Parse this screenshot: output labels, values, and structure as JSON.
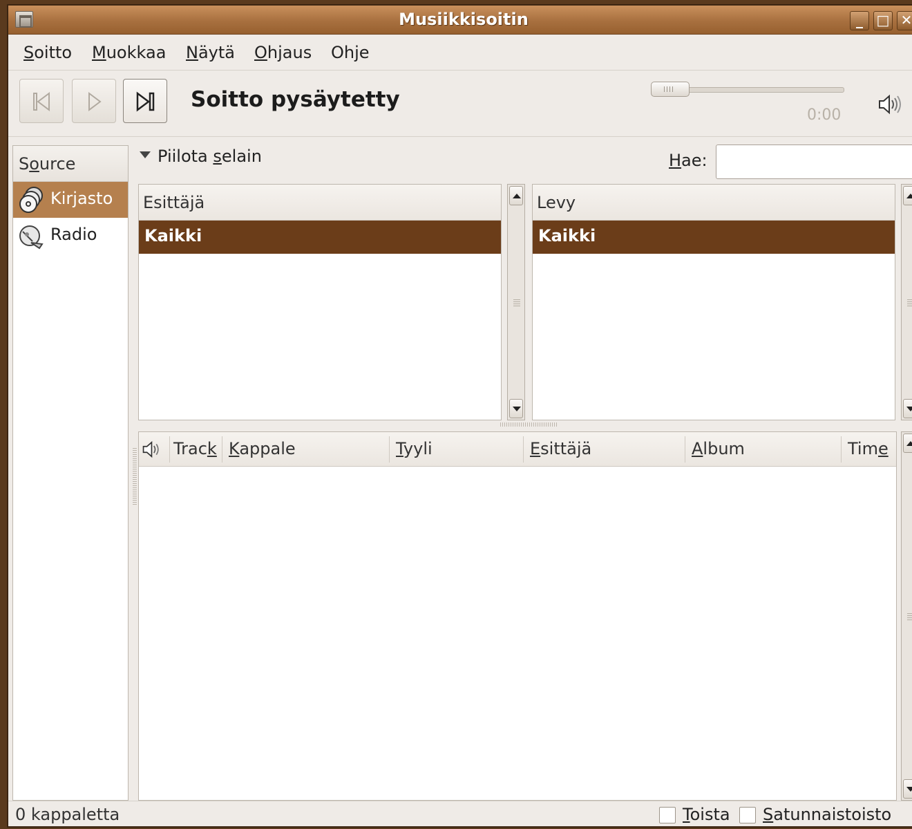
{
  "window": {
    "title": "Musiikkisoitin"
  },
  "menu": [
    {
      "pre": "",
      "u": "S",
      "post": "oitto"
    },
    {
      "pre": "",
      "u": "M",
      "post": "uokkaa"
    },
    {
      "pre": "",
      "u": "N",
      "post": "äytä"
    },
    {
      "pre": "",
      "u": "O",
      "post": "hjaus"
    },
    {
      "pre": "Oh",
      "u": "j",
      "post": "e"
    }
  ],
  "toolbar": {
    "status": "Soitto pysäytetty",
    "time": "0:00",
    "position_fraction": 0.0
  },
  "sidebar": {
    "header": {
      "pre": "S",
      "u": "o",
      "post": "urce"
    },
    "items": [
      {
        "label": "Kirjasto",
        "icon": "library-icon",
        "selected": true
      },
      {
        "label": "Radio",
        "icon": "radio-icon",
        "selected": false
      }
    ]
  },
  "browser": {
    "toggle": {
      "pre": "Piilota ",
      "u": "s",
      "post": "elain"
    },
    "search_label": {
      "pre": "",
      "u": "H",
      "post": "ae:"
    },
    "search_value": "",
    "artist_header": "Esittäjä",
    "artist_rows": [
      "Kaikki"
    ],
    "album_header": "Levy",
    "album_rows": [
      "Kaikki"
    ]
  },
  "tracklist": {
    "columns": [
      {
        "pre": "Trac",
        "u": "k",
        "post": ""
      },
      {
        "pre": "",
        "u": "K",
        "post": "appale"
      },
      {
        "pre": "",
        "u": "T",
        "post": "yyli"
      },
      {
        "pre": "",
        "u": "E",
        "post": "sittäjä"
      },
      {
        "pre": "",
        "u": "A",
        "post": "lbum"
      },
      {
        "pre": "Tim",
        "u": "e",
        "post": ""
      }
    ],
    "rows": []
  },
  "statusbar": {
    "count": "0 kappaletta",
    "repeat": {
      "pre": "",
      "u": "T",
      "post": "oista",
      "checked": false
    },
    "shuffle": {
      "pre": "",
      "u": "S",
      "post": "atunnaistoisto",
      "checked": false
    }
  },
  "colors": {
    "selection": "#6b3d19",
    "source_selected": "#b5804e",
    "titlebar": "#a8703f"
  }
}
